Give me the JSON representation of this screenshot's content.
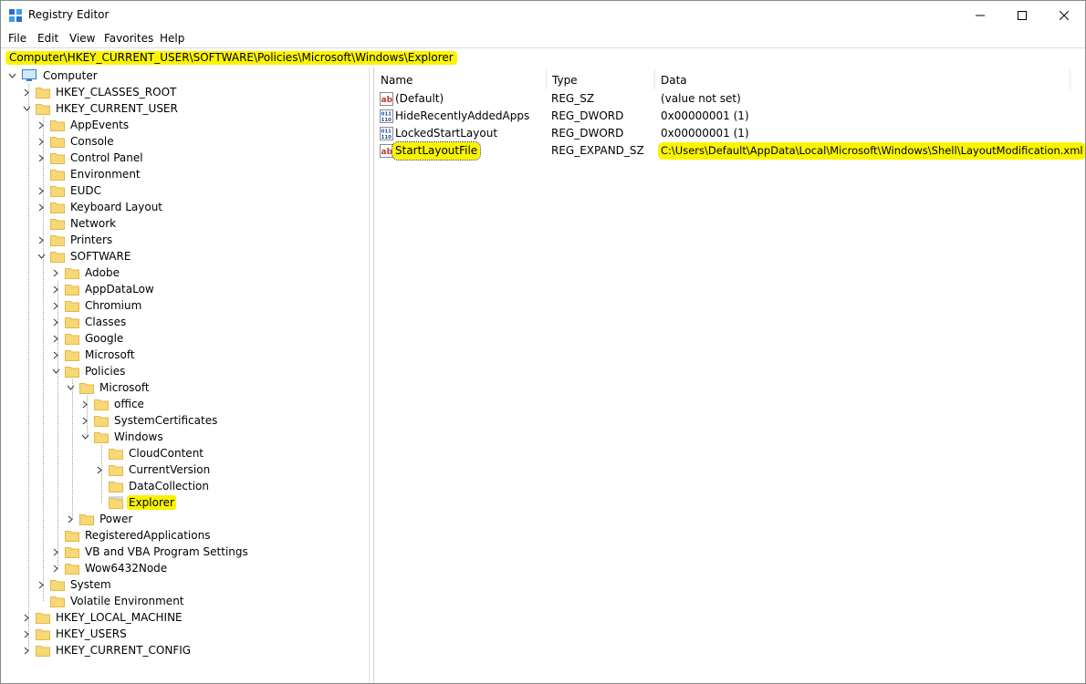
{
  "window": {
    "title": "Registry Editor"
  },
  "menu": {
    "items": [
      "File",
      "Edit",
      "View",
      "Favorites",
      "Help"
    ]
  },
  "address": {
    "path": "Computer\\HKEY_CURRENT_USER\\SOFTWARE\\Policies\\Microsoft\\Windows\\Explorer"
  },
  "tree": {
    "root": "Computer",
    "items": [
      "HKEY_CLASSES_ROOT",
      "HKEY_CURRENT_USER",
      "AppEvents",
      "Console",
      "Control Panel",
      "Environment",
      "EUDC",
      "Keyboard Layout",
      "Network",
      "Printers",
      "SOFTWARE",
      "Adobe",
      "AppDataLow",
      "Chromium",
      "Classes",
      "Google",
      "Microsoft",
      "Policies",
      "Microsoft",
      "office",
      "SystemCertificates",
      "Windows",
      "CloudContent",
      "CurrentVersion",
      "DataCollection",
      "Explorer",
      "Power",
      "RegisteredApplications",
      "VB and VBA Program Settings",
      "Wow6432Node",
      "System",
      "Volatile Environment",
      "HKEY_LOCAL_MACHINE",
      "HKEY_USERS",
      "HKEY_CURRENT_CONFIG"
    ],
    "selected": "Explorer"
  },
  "values": {
    "columns": [
      "Name",
      "Type",
      "Data"
    ],
    "rows": [
      {
        "name": "(Default)",
        "type": "REG_SZ",
        "data": "(value not set)",
        "icon": "string-value-icon"
      },
      {
        "name": "HideRecentlyAddedApps",
        "type": "REG_DWORD",
        "data": "0x00000001 (1)",
        "icon": "binary-value-icon"
      },
      {
        "name": "LockedStartLayout",
        "type": "REG_DWORD",
        "data": "0x00000001 (1)",
        "icon": "binary-value-icon"
      },
      {
        "name": "StartLayoutFile",
        "type": "REG_EXPAND_SZ",
        "data": "C:\\Users\\Default\\AppData\\Local\\Microsoft\\Windows\\Shell\\LayoutModification.xml",
        "icon": "string-value-icon"
      }
    ]
  },
  "colors": {
    "highlight": "#fbf400",
    "folder": "#f8d775"
  }
}
